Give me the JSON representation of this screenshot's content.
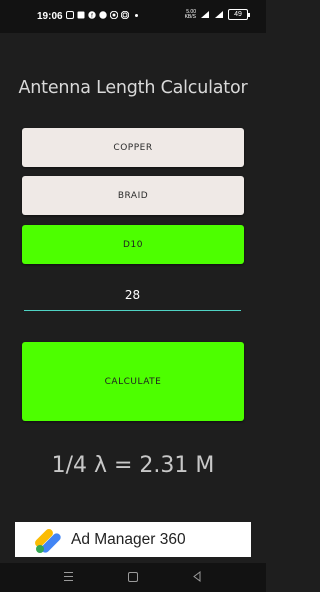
{
  "status_bar": {
    "time": "19:06",
    "net_speed_top": "5.00",
    "net_speed_bottom": "KB/S",
    "battery": "49"
  },
  "app": {
    "title": "Antenna Length Calculator",
    "material_button": "COPPER",
    "type_button": "BRAID",
    "diameter_button": "D10",
    "length_input": {
      "value": "28",
      "placeholder": ""
    },
    "calculate_button": "CALCULATE",
    "result": "1/4 λ = 2.31 M"
  },
  "ad": {
    "text": "Ad Manager 360"
  },
  "colors": {
    "background": "#1e1e1e",
    "button_light": "#efe9e6",
    "button_green": "#4dff00",
    "input_underline": "#4fd3c4"
  },
  "icons": {
    "nav_menu": "menu-icon",
    "nav_home": "home-icon",
    "nav_back": "back-icon",
    "ad_logo": "ad-manager-logo"
  }
}
